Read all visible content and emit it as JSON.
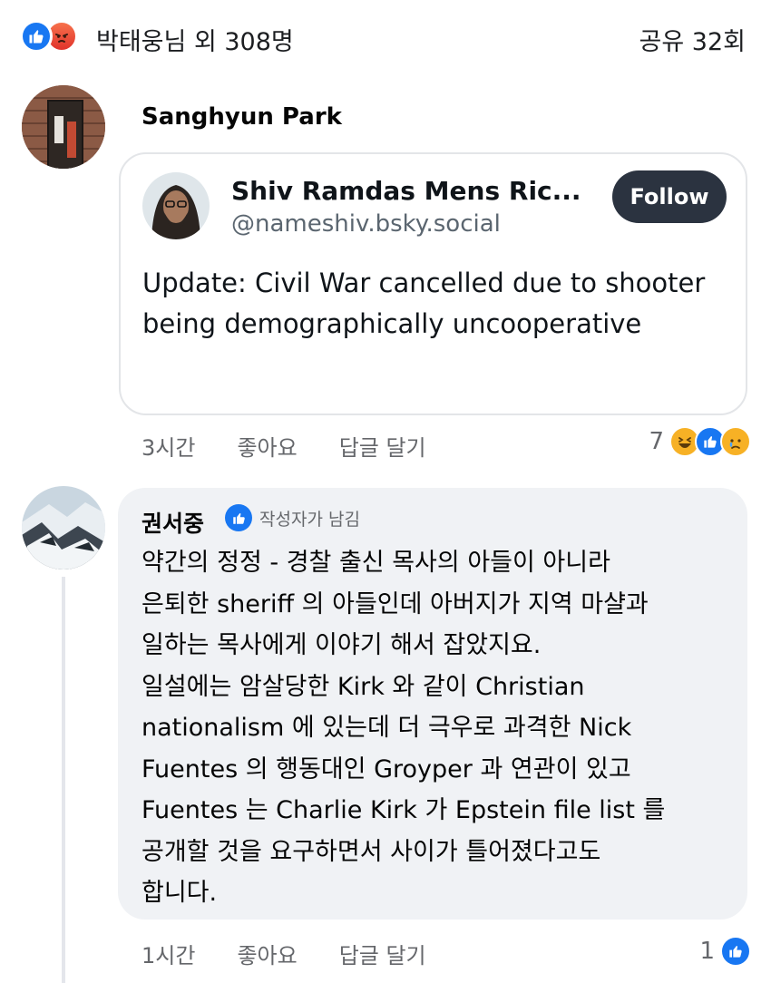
{
  "top_bar": {
    "reactions_text": "박태웅님 외 308명",
    "shares_text": "공유 32회"
  },
  "comment1": {
    "author": "Sanghyun Park",
    "embed": {
      "name": "Shiv Ramdas Mens Ric...",
      "handle": "@nameshiv.bsky.social",
      "follow_label": "Follow",
      "text": "Update: Civil War cancelled due to shooter being demographically uncooperative"
    },
    "time": "3시간",
    "like_label": "좋아요",
    "reply_label": "답글 달기",
    "reaction_count": "7"
  },
  "comment2": {
    "author": "권서중",
    "author_badge": "작성자가 남김",
    "text_lines": [
      "약간의 정정 - 경찰 출신 목사의 아들이 아니라",
      "은퇴한 sheriff 의 아들인데 아버지가 지역  마샬과",
      "일하는 목사에게 이야기 해서 잡았지요.",
      "일설에는 암살당한 Kirk 와 같이 Christian",
      "nationalism 에 있는데 더 극우로  과격한 Nick",
      "Fuentes 의 행동대인 Groyper 과 연관이 있고",
      "Fuentes 는 Charlie Kirk 가 Epstein file list 를",
      "공개할 것을 요구하면서 사이가 틀어졌다고도",
      "합니다."
    ],
    "time": "1시간",
    "like_label": "좋아요",
    "reply_label": "답글 달기",
    "reaction_count": "1"
  },
  "colors": {
    "facebook_blue": "#1877f2",
    "bubble_bg": "#f0f2f5",
    "follow_btn": "#2b3340",
    "secondary_text": "#65676b"
  }
}
